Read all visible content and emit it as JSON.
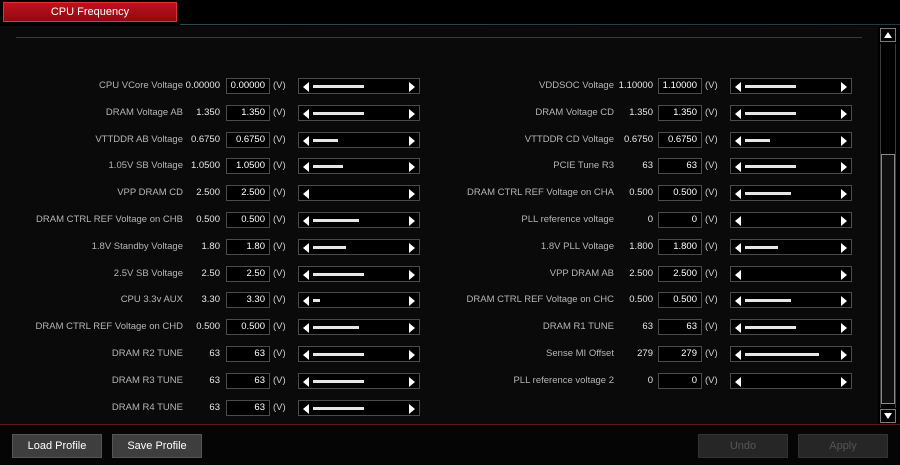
{
  "tab": {
    "label": "CPU Frequency"
  },
  "unit": "(V)",
  "left": [
    {
      "label": "CPU VCore Voltage",
      "current": "0.00000",
      "value": "0.00000",
      "level": 0.55
    },
    {
      "label": "DRAM Voltage AB",
      "current": "1.350",
      "value": "1.350",
      "level": 0.55
    },
    {
      "label": "VTTDDR AB Voltage",
      "current": "0.6750",
      "value": "0.6750",
      "level": 0.27
    },
    {
      "label": "1.05V SB Voltage",
      "current": "1.0500",
      "value": "1.0500",
      "level": 0.33
    },
    {
      "label": "VPP DRAM CD",
      "current": "2.500",
      "value": "2.500",
      "level": 0.0
    },
    {
      "label": "DRAM CTRL REF Voltage on CHB",
      "current": "0.500",
      "value": "0.500",
      "level": 0.5
    },
    {
      "label": "1.8V Standby Voltage",
      "current": "1.80",
      "value": "1.80",
      "level": 0.36
    },
    {
      "label": "2.5V SB Voltage",
      "current": "2.50",
      "value": "2.50",
      "level": 0.55
    },
    {
      "label": "CPU 3.3v AUX",
      "current": "3.30",
      "value": "3.30",
      "level": 0.08
    },
    {
      "label": "DRAM CTRL REF Voltage on CHD",
      "current": "0.500",
      "value": "0.500",
      "level": 0.5
    },
    {
      "label": "DRAM R2 TUNE",
      "current": "63",
      "value": "63",
      "level": 0.55
    },
    {
      "label": "DRAM R3 TUNE",
      "current": "63",
      "value": "63",
      "level": 0.55
    },
    {
      "label": "DRAM R4 TUNE",
      "current": "63",
      "value": "63",
      "level": 0.55
    }
  ],
  "right": [
    {
      "label": "VDDSOC Voltage",
      "current": "1.10000",
      "value": "1.10000",
      "level": 0.55
    },
    {
      "label": "DRAM Voltage CD",
      "current": "1.350",
      "value": "1.350",
      "level": 0.55
    },
    {
      "label": "VTTDDR CD Voltage",
      "current": "0.6750",
      "value": "0.6750",
      "level": 0.27
    },
    {
      "label": "PCIE Tune R3",
      "current": "63",
      "value": "63",
      "level": 0.55
    },
    {
      "label": "DRAM CTRL REF Voltage on CHA",
      "current": "0.500",
      "value": "0.500",
      "level": 0.5
    },
    {
      "label": "PLL reference voltage",
      "current": "0",
      "value": "0",
      "level": 0.0
    },
    {
      "label": "1.8V PLL Voltage",
      "current": "1.800",
      "value": "1.800",
      "level": 0.36
    },
    {
      "label": "VPP DRAM AB",
      "current": "2.500",
      "value": "2.500",
      "level": 0.0
    },
    {
      "label": "DRAM CTRL REF Voltage on CHC",
      "current": "0.500",
      "value": "0.500",
      "level": 0.5
    },
    {
      "label": "DRAM R1 TUNE",
      "current": "63",
      "value": "63",
      "level": 0.55
    },
    {
      "label": "Sense MI Offset",
      "current": "279",
      "value": "279",
      "level": 0.8
    },
    {
      "label": "PLL reference voltage 2",
      "current": "0",
      "value": "0",
      "level": 0.0
    }
  ],
  "buttons": {
    "load": "Load Profile",
    "save": "Save Profile",
    "undo": "Undo",
    "apply": "Apply"
  }
}
